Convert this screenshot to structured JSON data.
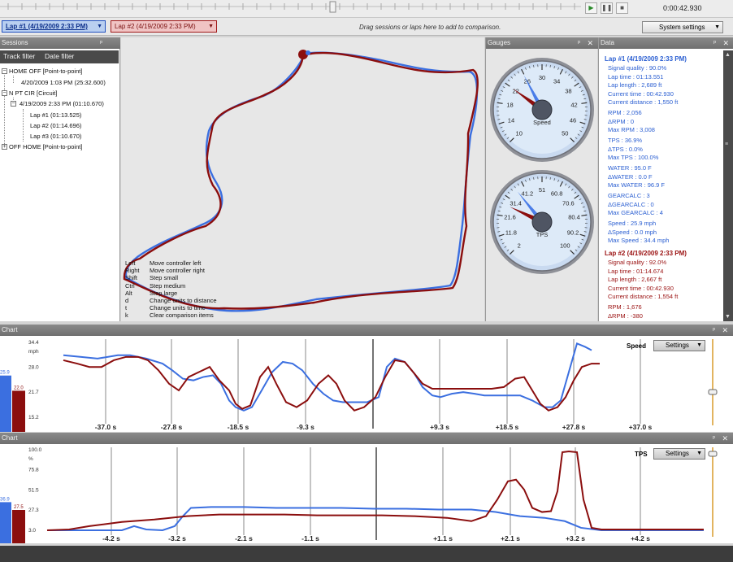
{
  "topbar": {
    "time": "0:00:42.930"
  },
  "lapbar": {
    "lap1_label": "Lap #1 (4/19/2009 2:33 PM)",
    "lap2_label": "Lap #2 (4/19/2009 2:33 PM)",
    "hint": "Drag sessions or laps here to add to comparison.",
    "system_settings": "System settings"
  },
  "sessions": {
    "title": "Sessions",
    "tabs": [
      "Track filter",
      "Date filter"
    ],
    "tree": [
      "HOME OFF [Point-to-point]",
      "4/20/2009 1:03 PM (25:32.600)",
      "N PT CIR [Circuit]",
      "4/19/2009 2:33 PM (01:10.670)",
      "Lap #1 (01:13.525)",
      "Lap #2 (01:14.696)",
      "Lap #3 (01:10.670)",
      "OFF HOME [Point-to-point]"
    ]
  },
  "map": {
    "shortcuts": [
      {
        "key": "Left",
        "desc": "Move controller left"
      },
      {
        "key": "Right",
        "desc": "Move controller right"
      },
      {
        "key": "Shift",
        "desc": "Step small"
      },
      {
        "key": "Ctrl",
        "desc": "Step medium"
      },
      {
        "key": "Alt",
        "desc": "Step large"
      },
      {
        "key": "d",
        "desc": "Change units to distance"
      },
      {
        "key": "t",
        "desc": "Change units to time"
      },
      {
        "key": "k",
        "desc": "Clear comparison items"
      }
    ]
  },
  "gauges": {
    "title": "Gauges",
    "speed": {
      "label": "Speed",
      "ticks": [
        "10",
        "14",
        "18",
        "22",
        "26",
        "30",
        "34",
        "38",
        "42",
        "46",
        "50"
      ],
      "lap1_value": 25.9,
      "lap2_value": 22.0
    },
    "tps": {
      "label": "TPS",
      "ticks": [
        "2",
        "11.8",
        "21.6",
        "31.4",
        "41.2",
        "51",
        "60.8",
        "70.6",
        "80.4",
        "90.2",
        "100"
      ],
      "lap1_value": 36.9,
      "lap2_value": 27.5
    }
  },
  "data": {
    "title": "Data",
    "lap1": {
      "header": "Lap #1 (4/19/2009 2:33 PM)",
      "rows": [
        "Signal quality : 90.0%",
        "Lap time : 01:13.551",
        "Lap length : 2,689 ft",
        "Current time : 00:42.930",
        "Current distance : 1,550 ft",
        "RPM : 2,056",
        "ΔRPM : 0",
        "Max RPM : 3,008",
        "TPS : 36.9%",
        "ΔTPS : 0.0%",
        "Max TPS : 100.0%",
        "WATER : 95.0 F",
        "ΔWATER : 0.0 F",
        "Max WATER : 96.9 F",
        "GEARCALC : 3",
        "ΔGEARCALC : 0",
        "Max GEARCALC : 4",
        "Speed : 25.9 mph",
        "ΔSpeed : 0.0 mph",
        "Max Speed : 34.4 mph"
      ]
    },
    "lap2": {
      "header": "Lap #2 (4/19/2009 2:33 PM)",
      "rows": [
        "Signal quality : 92.0%",
        "Lap time : 01:14.674",
        "Lap length : 2,667 ft",
        "Current time : 00:42.930",
        "Current distance : 1,554 ft",
        "RPM : 1,676",
        "ΔRPM : -380"
      ]
    }
  },
  "chart1": {
    "title": "Chart",
    "name": "Speed",
    "settings": "Settings",
    "unit": "mph",
    "yticks": [
      "34.4",
      "28.0",
      "21.7",
      "15.2"
    ],
    "xticks": [
      "-37.0 s",
      "-27.8 s",
      "-18.5 s",
      "-9.3 s",
      "+9.3 s",
      "+18.5 s",
      "+27.8 s",
      "+37.0 s"
    ],
    "bar_values": [
      "25.9",
      "22.0"
    ]
  },
  "chart2": {
    "title": "Chart",
    "name": "TPS",
    "settings": "Settings",
    "unit": "%",
    "yticks": [
      "100.0",
      "75.8",
      "51.5",
      "27.3",
      "3.0"
    ],
    "xticks": [
      "-4.2 s",
      "-3.2 s",
      "-2.1 s",
      "-1.1 s",
      "+1.1 s",
      "+2.1 s",
      "+3.2 s",
      "+4.2 s"
    ],
    "bar_values": [
      "36.9",
      "27.5"
    ]
  },
  "colors": {
    "lap1": "#3b6fe0",
    "lap2": "#8b0e0e"
  }
}
